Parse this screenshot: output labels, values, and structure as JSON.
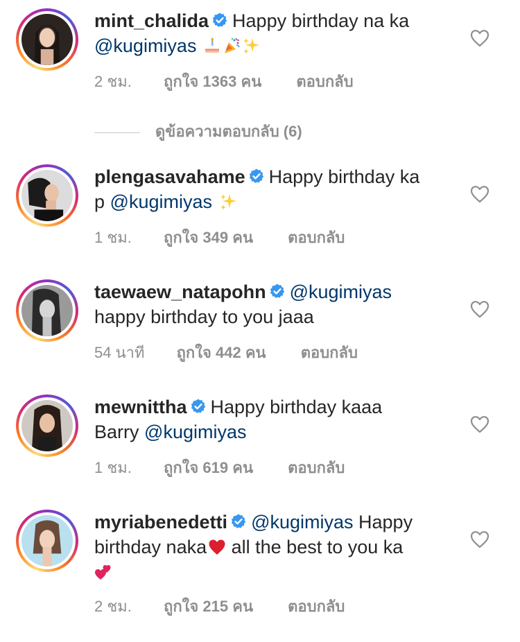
{
  "colors": {
    "accent_text": "#262626",
    "mention": "#00376b",
    "meta": "#8e8e8e",
    "verified": "#3897f0"
  },
  "view_replies": "ดูข้อความตอบกลับ (6)",
  "comments": [
    {
      "username": "mint_chalida",
      "line1": "Happy birthday na ka",
      "mention": "@kugimiyas",
      "emojis": [
        "birthday-cake-icon",
        "party-popper-icon",
        "sparkles-icon"
      ],
      "time": "2 ชม.",
      "likes": "ถูกใจ 1363 คน",
      "reply": "ตอบกลับ"
    },
    {
      "username": "plengasavahame",
      "line1": "Happy birthday ka",
      "line2_prefix": "p",
      "mention": "@kugimiyas",
      "emojis": [
        "sparkles-icon"
      ],
      "time": "1 ชม.",
      "likes": "ถูกใจ 349 คน",
      "reply": "ตอบกลับ"
    },
    {
      "username": "taewaew_natapohn",
      "mention": "@kugimiyas",
      "line2": "happy birthday to you jaaa",
      "time": "54 นาที",
      "likes": "ถูกใจ 442 คน",
      "reply": "ตอบกลับ"
    },
    {
      "username": "mewnittha",
      "line1": "Happy birthday kaaa",
      "line2_prefix": "Barry",
      "mention": "@kugimiyas",
      "time": "1 ชม.",
      "likes": "ถูกใจ 619 คน",
      "reply": "ตอบกลับ"
    },
    {
      "username": "myriabenedetti",
      "mention": "@kugimiyas",
      "line1_suffix": "Happy",
      "line2_a": "birthday naka",
      "line2_b": "all the best to you ka",
      "emojis": [
        "red-heart-icon",
        "two-hearts-icon"
      ],
      "time": "2 ชม.",
      "likes": "ถูกใจ 215 คน",
      "reply": "ตอบกลับ"
    }
  ]
}
